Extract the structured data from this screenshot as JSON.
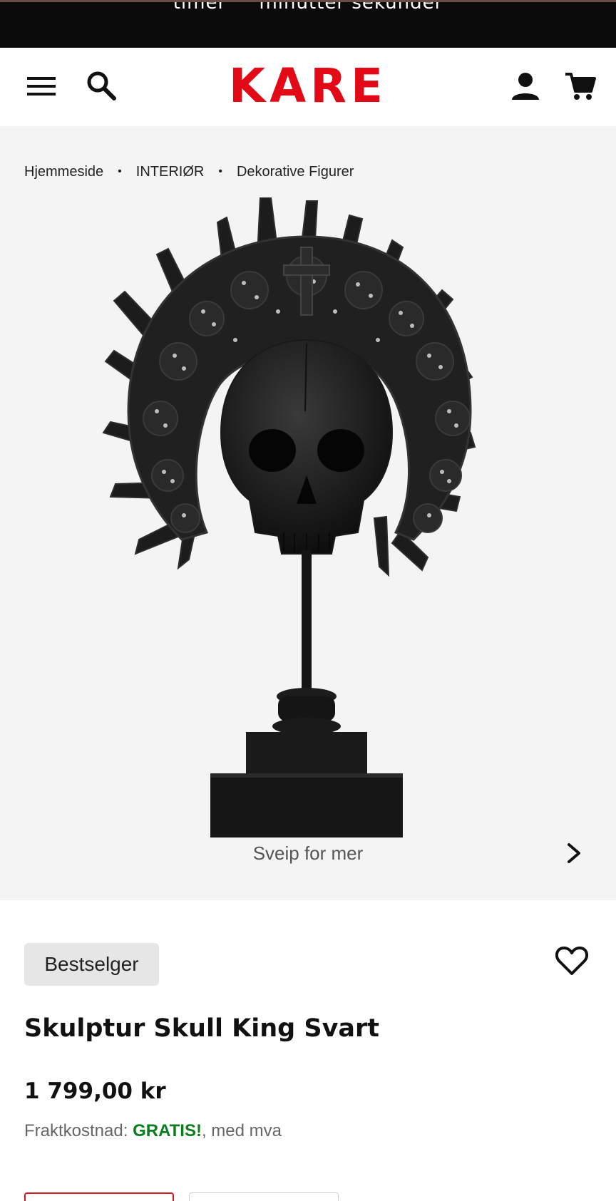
{
  "promo": {
    "text": "timer     minutter sekunder"
  },
  "header": {
    "logo": "KARE",
    "menu_icon": "hamburger-menu-icon",
    "search_icon": "search-icon",
    "account_icon": "account-icon",
    "cart_icon": "cart-icon"
  },
  "breadcrumb": {
    "items": [
      "Hjemmeside",
      "INTERIØR",
      "Dekorative Figurer"
    ],
    "separator": "•"
  },
  "gallery": {
    "swipe_label": "Sveip for mer",
    "next_icon": "chevron-right-icon"
  },
  "product": {
    "badge": "Bestselger",
    "title": "Skulptur Skull King Svart",
    "price": "1 799,00 kr",
    "shipping_label": "Fraktkostnad:",
    "shipping_value": "GRATIS!",
    "shipping_suffix": ", med mva",
    "wishlist_icon": "heart-icon"
  },
  "colors": {
    "brand": "#e10a16",
    "free_shipping": "#0a7d1c",
    "promo_bg": "#0b0b0b",
    "gallery_bg": "#f4f4f4",
    "badge_bg": "#e6e6e6"
  }
}
